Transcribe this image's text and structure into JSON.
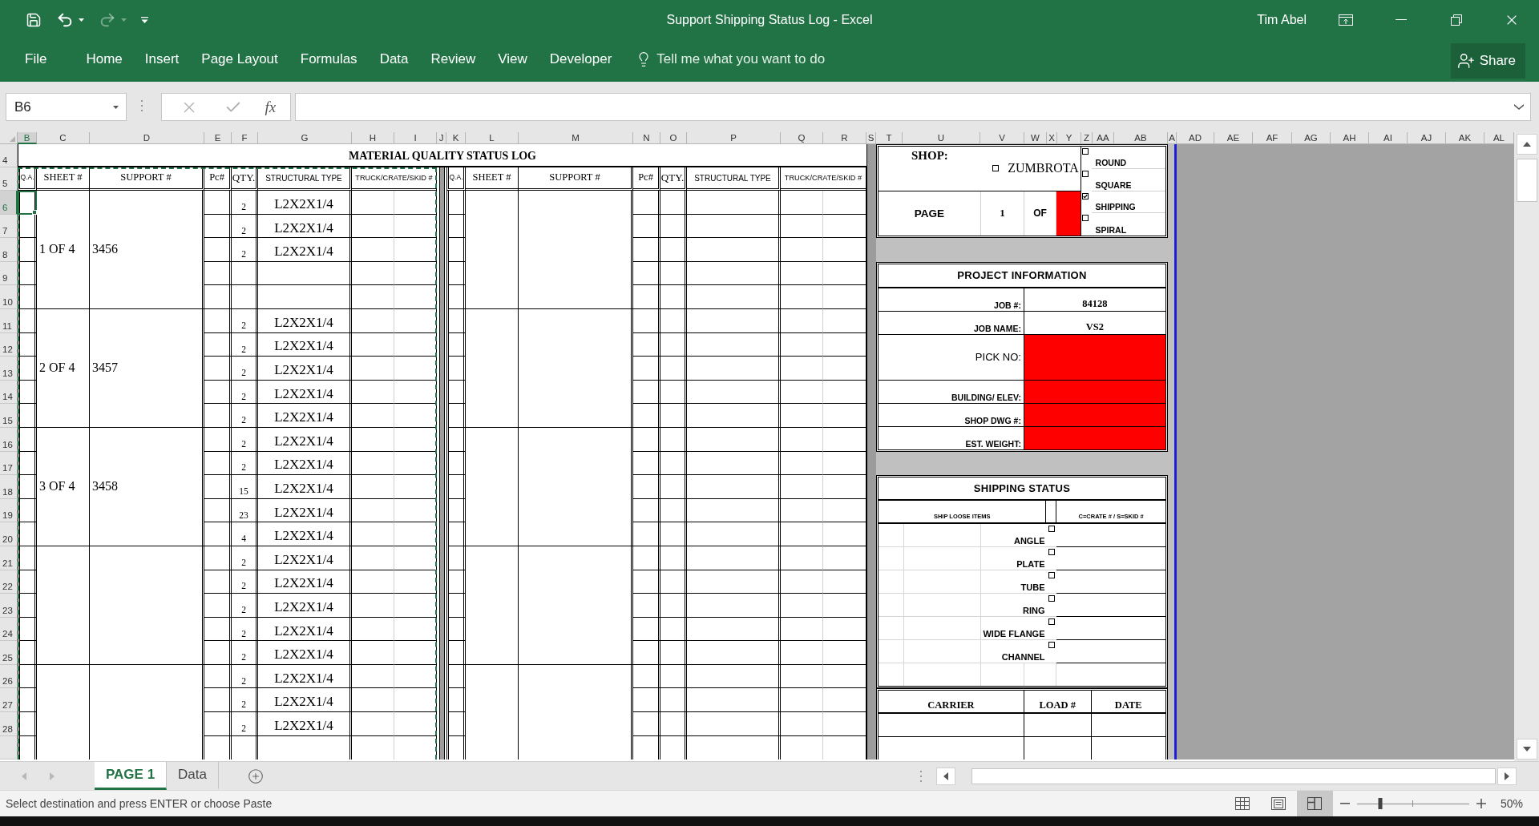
{
  "window": {
    "title": "Support Shipping Status Log - Excel",
    "user": "Tim Abel"
  },
  "quick_access": [
    {
      "kind": "save",
      "disabled": false
    },
    {
      "kind": "undo",
      "disabled": false
    },
    {
      "kind": "redo",
      "disabled": true
    },
    {
      "kind": "customize",
      "disabled": false
    }
  ],
  "ribbon": {
    "tabs": [
      {
        "label": "File",
        "selected": false
      },
      {
        "label": "Home",
        "selected": false
      },
      {
        "label": "Insert",
        "selected": false
      },
      {
        "label": "Page Layout",
        "selected": false
      },
      {
        "label": "Formulas",
        "selected": false
      },
      {
        "label": "Data",
        "selected": false
      },
      {
        "label": "Review",
        "selected": false
      },
      {
        "label": "View",
        "selected": false
      },
      {
        "label": "Developer",
        "selected": false
      }
    ],
    "tell_me": {
      "placeholder": "Tell me what you want to do"
    },
    "share": "Share"
  },
  "formula_bar": {
    "name_box": "B6",
    "edit_buttons": [
      {
        "kind": "cancel",
        "disabled": true
      },
      {
        "kind": "enter",
        "disabled": true
      }
    ],
    "function_button": "fx"
  },
  "column_headers": [
    {
      "label": "B",
      "selected": true
    },
    {
      "label": "C",
      "selected": false
    },
    {
      "label": "D",
      "selected": false
    },
    {
      "label": "E",
      "selected": false
    },
    {
      "label": "F",
      "selected": false
    },
    {
      "label": "G",
      "selected": false
    },
    {
      "label": "H",
      "selected": false
    },
    {
      "label": "I",
      "selected": false
    },
    {
      "label": "J",
      "selected": false
    },
    {
      "label": "K",
      "selected": false
    },
    {
      "label": "L",
      "selected": false
    },
    {
      "label": "M",
      "selected": false
    },
    {
      "label": "N",
      "selected": false
    },
    {
      "label": "O",
      "selected": false
    },
    {
      "label": "P",
      "selected": false
    },
    {
      "label": "Q",
      "selected": false
    },
    {
      "label": "R",
      "selected": false
    },
    {
      "label": "S",
      "selected": false
    },
    {
      "label": "T",
      "selected": false
    },
    {
      "label": "U",
      "selected": false
    },
    {
      "label": "V",
      "selected": false
    },
    {
      "label": "W",
      "selected": false
    },
    {
      "label": "X",
      "selected": false
    },
    {
      "label": "Y",
      "selected": false
    },
    {
      "label": "Z",
      "selected": false
    },
    {
      "label": "AA",
      "selected": false
    },
    {
      "label": "AB",
      "selected": false
    },
    {
      "label": "A",
      "selected": false
    },
    {
      "label": "AD",
      "selected": false
    },
    {
      "label": "AE",
      "selected": false
    },
    {
      "label": "AF",
      "selected": false
    },
    {
      "label": "AG",
      "selected": false
    },
    {
      "label": "AH",
      "selected": false
    },
    {
      "label": "AI",
      "selected": false
    },
    {
      "label": "AJ",
      "selected": false
    },
    {
      "label": "AK",
      "selected": false
    },
    {
      "label": "AL",
      "selected": false
    }
  ],
  "row_headers": [
    {
      "label": "4",
      "selected": false
    },
    {
      "label": "5",
      "selected": false
    },
    {
      "label": "6",
      "selected": true
    },
    {
      "label": "7",
      "selected": false
    },
    {
      "label": "8",
      "selected": false
    },
    {
      "label": "9",
      "selected": false
    },
    {
      "label": "10",
      "selected": false
    },
    {
      "label": "11",
      "selected": false
    },
    {
      "label": "12",
      "selected": false
    },
    {
      "label": "13",
      "selected": false
    },
    {
      "label": "14",
      "selected": false
    },
    {
      "label": "15",
      "selected": false
    },
    {
      "label": "16",
      "selected": false
    },
    {
      "label": "17",
      "selected": false
    },
    {
      "label": "18",
      "selected": false
    },
    {
      "label": "19",
      "selected": false
    },
    {
      "label": "20",
      "selected": false
    },
    {
      "label": "21",
      "selected": false
    },
    {
      "label": "22",
      "selected": false
    },
    {
      "label": "23",
      "selected": false
    },
    {
      "label": "24",
      "selected": false
    },
    {
      "label": "25",
      "selected": false
    },
    {
      "label": "26",
      "selected": false
    },
    {
      "label": "27",
      "selected": false
    },
    {
      "label": "28",
      "selected": false
    }
  ],
  "log": {
    "title": "MATERIAL QUALITY STATUS LOG",
    "tables": [
      {
        "marquee": true,
        "columns": [
          "Q.A.",
          "SHEET #",
          "SUPPORT #",
          "Pc#",
          "QTY.",
          "STRUCTURAL TYPE",
          "TRUCK/CRATE/SKID #"
        ],
        "groups": [
          {
            "sheet": "1 OF 4",
            "support": "3456",
            "items": [
              {
                "qty": "2",
                "type": "L2X2X1/4"
              },
              {
                "qty": "2",
                "type": "L2X2X1/4"
              },
              {
                "qty": "2",
                "type": "L2X2X1/4"
              }
            ]
          },
          {
            "sheet": "2 OF 4",
            "support": "3457",
            "items": [
              {
                "qty": "2",
                "type": "L2X2X1/4"
              },
              {
                "qty": "2",
                "type": "L2X2X1/4"
              },
              {
                "qty": "2",
                "type": "L2X2X1/4"
              },
              {
                "qty": "2",
                "type": "L2X2X1/4"
              },
              {
                "qty": "2",
                "type": "L2X2X1/4"
              }
            ]
          },
          {
            "sheet": "3 OF 4",
            "support": "3458",
            "items": [
              {
                "qty": "2",
                "type": "L2X2X1/4"
              },
              {
                "qty": "2",
                "type": "L2X2X1/4"
              },
              {
                "qty": "15",
                "type": "L2X2X1/4"
              },
              {
                "qty": "23",
                "type": "L2X2X1/4"
              },
              {
                "qty": "4",
                "type": "L2X2X1/4"
              }
            ]
          },
          {
            "items": [
              {
                "qty": "2",
                "type": "L2X2X1/4"
              },
              {
                "qty": "2",
                "type": "L2X2X1/4"
              },
              {
                "qty": "2",
                "type": "L2X2X1/4"
              },
              {
                "qty": "2",
                "type": "L2X2X1/4"
              },
              {
                "qty": "2",
                "type": "L2X2X1/4"
              }
            ]
          },
          {
            "items": [
              {
                "qty": "2",
                "type": "L2X2X1/4"
              },
              {
                "qty": "2",
                "type": "L2X2X1/4"
              },
              {
                "qty": "2",
                "type": "L2X2X1/4"
              }
            ]
          }
        ]
      },
      {
        "columns": [
          "Q.A.",
          "SHEET #",
          "SUPPORT #",
          "Pc#",
          "QTY.",
          "STRUCTURAL TYPE",
          "TRUCK/CRATE/SKID #"
        ]
      }
    ]
  },
  "shop_box": {
    "label": "SHOP:",
    "location": {
      "label": "ZUMBROTA",
      "checked": false
    },
    "page_label": "PAGE",
    "page_number": "1",
    "of_label": "OF",
    "page_total": {
      "flagged": true
    },
    "options": [
      {
        "label": "ROUND",
        "checked": false
      },
      {
        "label": "SQUARE",
        "checked": false
      },
      {
        "label": "SHIPPING",
        "checked": true
      },
      {
        "label": "SPIRAL",
        "checked": false
      }
    ]
  },
  "project_information": {
    "title": "PROJECT INFORMATION",
    "fields": [
      {
        "label": "JOB #:",
        "value": "84128",
        "kind": "normal",
        "flagged": false
      },
      {
        "label": "JOB NAME:",
        "value": "VS2",
        "kind": "normal",
        "flagged": false
      },
      {
        "label": "PICK NO:",
        "kind": "tall",
        "flagged": true
      },
      {
        "label": "BUILDING/ ELEV:",
        "kind": "normal",
        "flagged": true
      },
      {
        "label": "SHOP DWG #:",
        "kind": "normal",
        "flagged": true
      },
      {
        "label": "EST. WEIGHT:",
        "kind": "normal",
        "flagged": true
      }
    ]
  },
  "shipping_status": {
    "title": "SHIPPING STATUS",
    "columns": [
      "SHIP LOOSE ITEMS",
      "C=CRATE # / S=SKID #"
    ],
    "items": [
      {
        "label": "ANGLE",
        "checked": false
      },
      {
        "label": "PLATE",
        "checked": false
      },
      {
        "label": "TUBE",
        "checked": false
      },
      {
        "label": "RING",
        "checked": false
      },
      {
        "label": "WIDE FLANGE",
        "checked": false
      },
      {
        "label": "CHANNEL",
        "checked": false
      }
    ]
  },
  "carrier_table": {
    "columns": [
      "CARRIER",
      "LOAD #",
      "DATE"
    ]
  },
  "sheet_tabs": {
    "scroll_buttons": [
      {
        "kind": "previous",
        "disabled": true
      },
      {
        "kind": "next",
        "disabled": true
      }
    ],
    "tabs": [
      {
        "label": "PAGE 1",
        "selected": true
      },
      {
        "label": "Data",
        "selected": false
      }
    ]
  },
  "status_bar": {
    "message": "Select destination and press ENTER or choose Paste",
    "views": [
      {
        "kind": "normal",
        "selected": false
      },
      {
        "kind": "page_layout",
        "selected": false
      },
      {
        "kind": "page_break",
        "selected": true
      }
    ],
    "zoom": {
      "label": "50%",
      "level": 0.21
    }
  }
}
